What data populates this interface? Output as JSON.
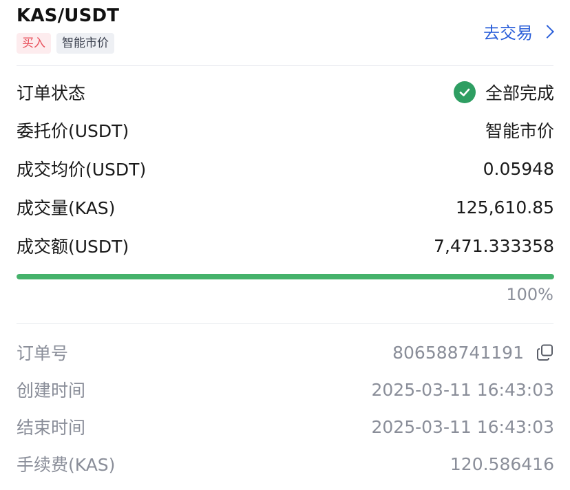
{
  "header": {
    "pair": "KAS/USDT",
    "side_tag": "买入",
    "type_tag": "智能市价",
    "trade_link": "去交易"
  },
  "details": {
    "status_label": "订单状态",
    "status_value": "全部完成",
    "price_label": "委托价(USDT)",
    "price_value": "智能市价",
    "avg_label": "成交均价(USDT)",
    "avg_value": "0.05948",
    "qty_label": "成交量(KAS)",
    "qty_value": "125,610.85",
    "amount_label": "成交额(USDT)",
    "amount_value": "7,471.333358"
  },
  "progress": {
    "fill_fraction": 1.0,
    "percent_text": "100%"
  },
  "meta": {
    "order_no_label": "订单号",
    "order_no_value": "806588741191",
    "created_label": "创建时间",
    "created_value": "2025-03-11 16:43:03",
    "ended_label": "结束时间",
    "ended_value": "2025-03-11 16:43:03",
    "fee_label": "手续费(KAS)",
    "fee_value": "120.586416"
  },
  "colors": {
    "accent": "#2b5fd9",
    "success": "#2e9e62",
    "progress": "#45b26b",
    "buy": "#e8505b"
  }
}
